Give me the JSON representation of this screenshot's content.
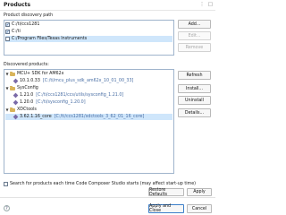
{
  "dialog": {
    "title": "Products"
  },
  "discovery": {
    "section_label": "Product discovery path",
    "paths": [
      {
        "label": "C:/ti/ccs1281",
        "checked": true,
        "selected": false
      },
      {
        "label": "C:/ti",
        "checked": true,
        "selected": false
      },
      {
        "label": "C:/Program Files/Texas Instruments",
        "checked": false,
        "selected": true
      }
    ],
    "buttons": {
      "add": "Add...",
      "edit": "Edit...",
      "remove": "Remove"
    }
  },
  "discovered": {
    "section_label": "Discovered products:",
    "tree": [
      {
        "label": "MCU+ SDK for AM62x",
        "path": "",
        "level": 0,
        "expanded": true,
        "icon": "folder"
      },
      {
        "label": "10.1.0.33",
        "path": "[C:/ti/mcu_plus_sdk_am62x_10_01_00_33]",
        "level": 1,
        "icon": "package"
      },
      {
        "label": "SysConfig",
        "path": "",
        "level": 0,
        "expanded": true,
        "icon": "folder"
      },
      {
        "label": "1.21.0",
        "path": "[C:/ti/ccs1281/ccs/utils/sysconfig_1.21.0]",
        "level": 1,
        "icon": "package"
      },
      {
        "label": "1.20.0",
        "path": "[C:/ti/sysconfig_1.20.0]",
        "level": 1,
        "icon": "package"
      },
      {
        "label": "XDCtools",
        "path": "",
        "level": 0,
        "expanded": true,
        "icon": "folder"
      },
      {
        "label": "3.62.1.16_core",
        "path": "[C:/ti/ccs1281/xdctools_3_62_01_16_core]",
        "level": 1,
        "icon": "package",
        "selected": true
      }
    ],
    "buttons": {
      "refresh": "Refresh",
      "install": "Install...",
      "uninstall": "Uninstall",
      "details": "Details..."
    }
  },
  "footer": {
    "search_checkbox": "Search for products each time Code Composer Studio starts (may affect start-up time)",
    "restore_defaults": "Restore Defaults",
    "apply": "Apply",
    "apply_and_close": "Apply and Close",
    "cancel": "Cancel"
  },
  "icons": {
    "menu": "kebab-menu-icon",
    "maximize": "maximize-icon",
    "close": "close-icon",
    "help": "help-icon"
  }
}
